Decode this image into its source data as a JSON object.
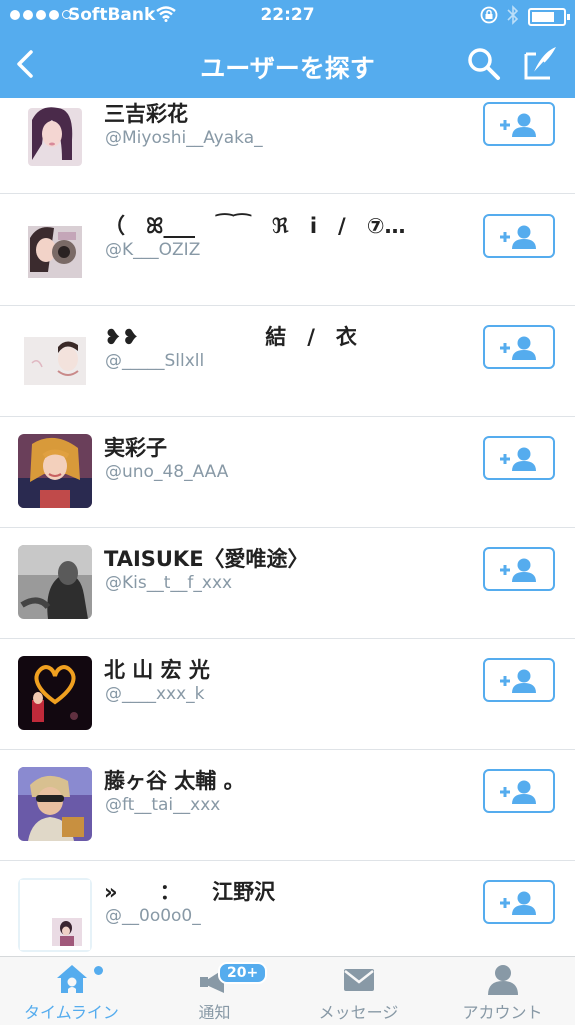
{
  "status_bar": {
    "carrier": "SoftBank",
    "time": "22:27"
  },
  "nav": {
    "title": "ユーザーを探す",
    "back_icon": "chevron-left-icon",
    "search_icon": "search-icon",
    "compose_icon": "compose-icon"
  },
  "users": [
    {
      "name": "三吉彩花",
      "handle": "@Miyoshi__Ayaka_"
    },
    {
      "name": "（　ꕤ___　⁀⁀　ℜ　i　/　⑦…",
      "handle": "@K___OZIZ"
    },
    {
      "name": "❥❥　　　　　　結　/　衣　　　　　　.",
      "handle": "@_____Sllxll"
    },
    {
      "name": "実彩子",
      "handle": "@uno_48_AAA"
    },
    {
      "name": "TAISUKE〈愛唯途〉",
      "handle": "@Kis__t__f_xxx"
    },
    {
      "name": "北 山 宏 光",
      "handle": "@____xxx_k"
    },
    {
      "name": "藤ヶ谷 太輔 。",
      "handle": "@ft__tai__xxx"
    },
    {
      "name": "»　　：　　江野沢",
      "handle": "@__0o0o0_"
    }
  ],
  "tabs": [
    {
      "label": "タイムライン",
      "icon": "home-icon"
    },
    {
      "label": "通知",
      "icon": "notification-icon",
      "badge": "20+"
    },
    {
      "label": "メッセージ",
      "icon": "message-icon"
    },
    {
      "label": "アカウント",
      "icon": "account-icon"
    }
  ],
  "colors": {
    "accent": "#55acee",
    "text": "#222222",
    "muted": "#8899a6"
  }
}
